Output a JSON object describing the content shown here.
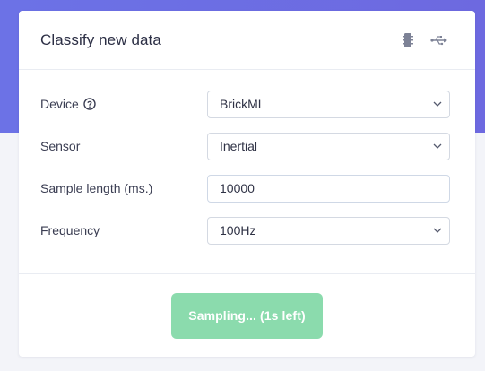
{
  "card": {
    "title": "Classify new data",
    "header_icons": [
      "chip-icon",
      "usb-icon"
    ]
  },
  "form": {
    "device": {
      "label": "Device",
      "value": "BrickML",
      "help_icon": "question-circle-icon"
    },
    "sensor": {
      "label": "Sensor",
      "value": "Inertial"
    },
    "sample_length": {
      "label": "Sample length (ms.)",
      "value": "10000"
    },
    "frequency": {
      "label": "Frequency",
      "value": "100Hz"
    }
  },
  "footer": {
    "button_label": "Sampling... (1s left)"
  },
  "colors": {
    "header_band": "#6c72e6",
    "page_bg": "#f3f4f9",
    "button_bg": "#8bdbad"
  }
}
